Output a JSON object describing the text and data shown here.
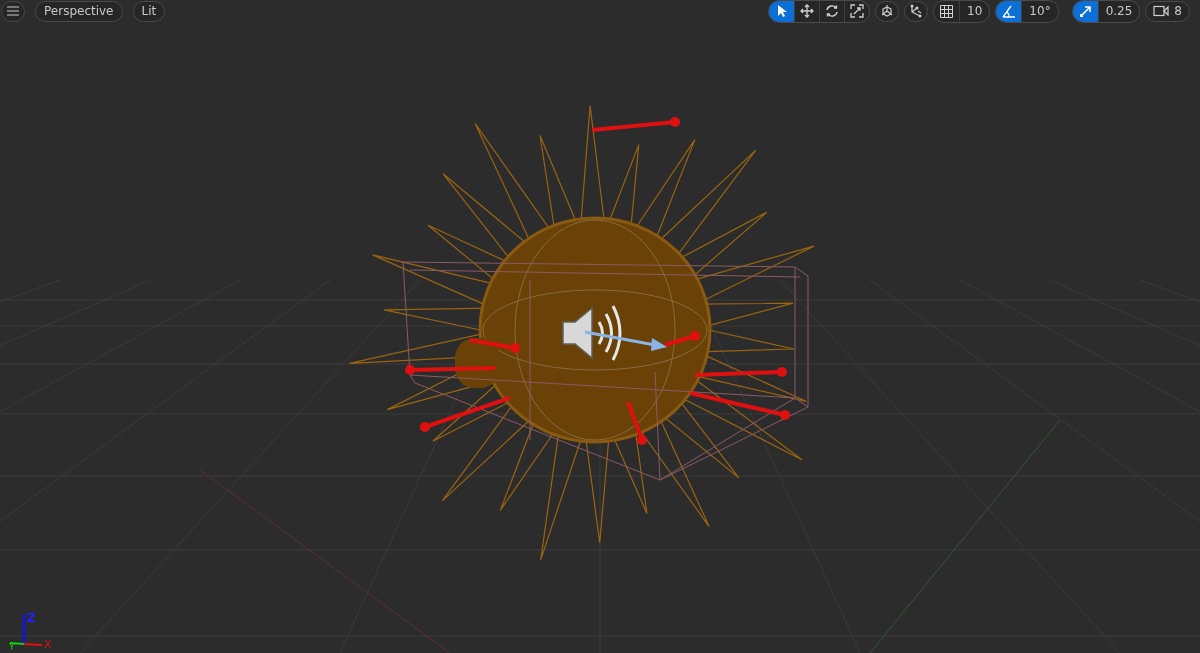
{
  "toolbar": {
    "view_modes": [
      {
        "label": "Perspective"
      },
      {
        "label": "Lit"
      }
    ],
    "transform_tools": [
      {
        "kind": "select",
        "selected": true
      },
      {
        "kind": "move",
        "selected": false
      },
      {
        "kind": "rotate",
        "selected": false
      },
      {
        "kind": "scale",
        "selected": false
      }
    ],
    "grid_snap": {
      "on": false,
      "value": "10"
    },
    "rotation_snap": {
      "on": true,
      "value": "10°"
    },
    "scale_snap": {
      "on": true,
      "value": "0.25"
    },
    "camera_speed": {
      "value": "8"
    }
  },
  "axis_gizmo": {
    "x": "X",
    "y": "Y",
    "z": "Z"
  }
}
